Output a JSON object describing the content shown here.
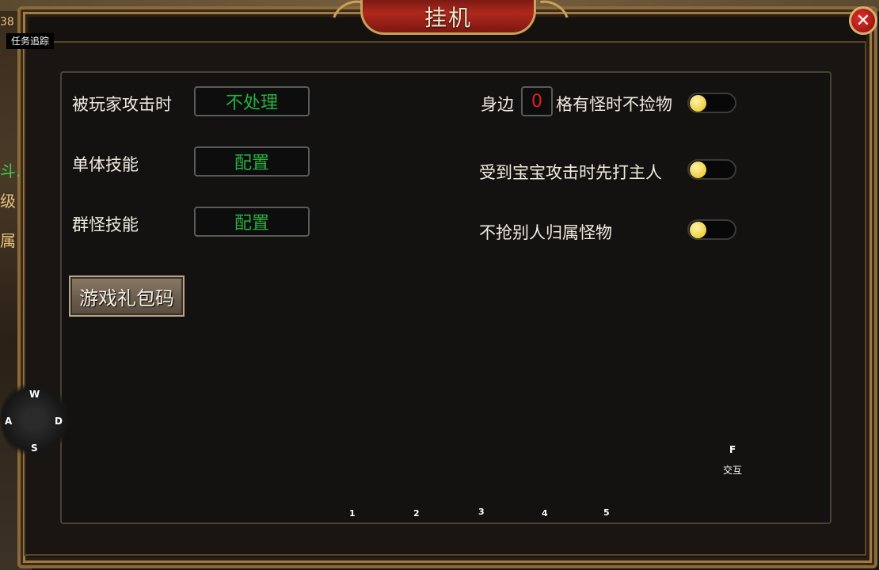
{
  "window": {
    "title": "挂机",
    "close_label": "✕"
  },
  "sidebar": {
    "task_tab": "任务追踪",
    "fragments": [
      "38",
      "斗.",
      "级",
      "属"
    ]
  },
  "left_settings": [
    {
      "label": "被玩家攻击时",
      "value": "不处理"
    },
    {
      "label": "单体技能",
      "value": "配置"
    },
    {
      "label": "群怪技能",
      "value": "配置"
    }
  ],
  "gift_button": "游戏礼包码",
  "right_settings": {
    "nearby_prefix": "身边",
    "nearby_value": "0",
    "nearby_suffix": "格有怪时不捡物",
    "pet_attack": "受到宝宝攻击时先打主人",
    "no_steal": "不抢别人归属怪物"
  },
  "joystick": {
    "up": "W",
    "left": "A",
    "down": "S",
    "right": "D"
  },
  "hotbar": [
    "1",
    "2",
    "3",
    "4",
    "5"
  ],
  "interact": {
    "key": "F",
    "label": "交互"
  },
  "colors": {
    "accent_green": "#25b040",
    "value_red": "#e0241c",
    "knob": "#f0d040"
  }
}
